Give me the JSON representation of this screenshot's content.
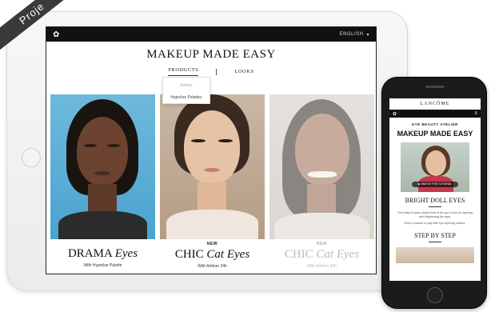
{
  "ribbon": {
    "label": "Proje"
  },
  "ipad": {
    "topbar": {
      "logo_icon": "rose-icon",
      "language": "ENGLISH"
    },
    "hero_title": "MAKEUP MADE EASY",
    "tabs": [
      {
        "label": "PRODUCTS"
      },
      {
        "label": "LOOKS"
      }
    ],
    "dropdown": {
      "options": [
        "Artliner",
        "Hypnôse Palettes"
      ]
    },
    "cards": [
      {
        "badge": "",
        "title_main": "DRAMA",
        "title_italic": "Eyes",
        "subtitle": "With Hypnôse Palette"
      },
      {
        "badge": "NEW",
        "title_main": "CHIC",
        "title_italic": "Cat Eyes",
        "subtitle": "With Artliner 24h"
      },
      {
        "badge": "NEW",
        "title_main": "CHIC",
        "title_italic": "Cat Eyes",
        "subtitle": "With Artliner 24h"
      }
    ]
  },
  "iphone": {
    "brand": "LANCÔME",
    "kicker": "EYE BEAUTY ATELIER",
    "title": "MAKEUP MADE EASY",
    "video_label": "WATCH THE TUTORIAL",
    "section_title": "BRIGHT DOLL EYES",
    "body1": "This easy-to-wear, playful liner is the go-to look for opening and brightening the eyes.",
    "body2": "Keep it natural or play with eye-opening colours.",
    "step_title": "STEP BY STEP"
  }
}
